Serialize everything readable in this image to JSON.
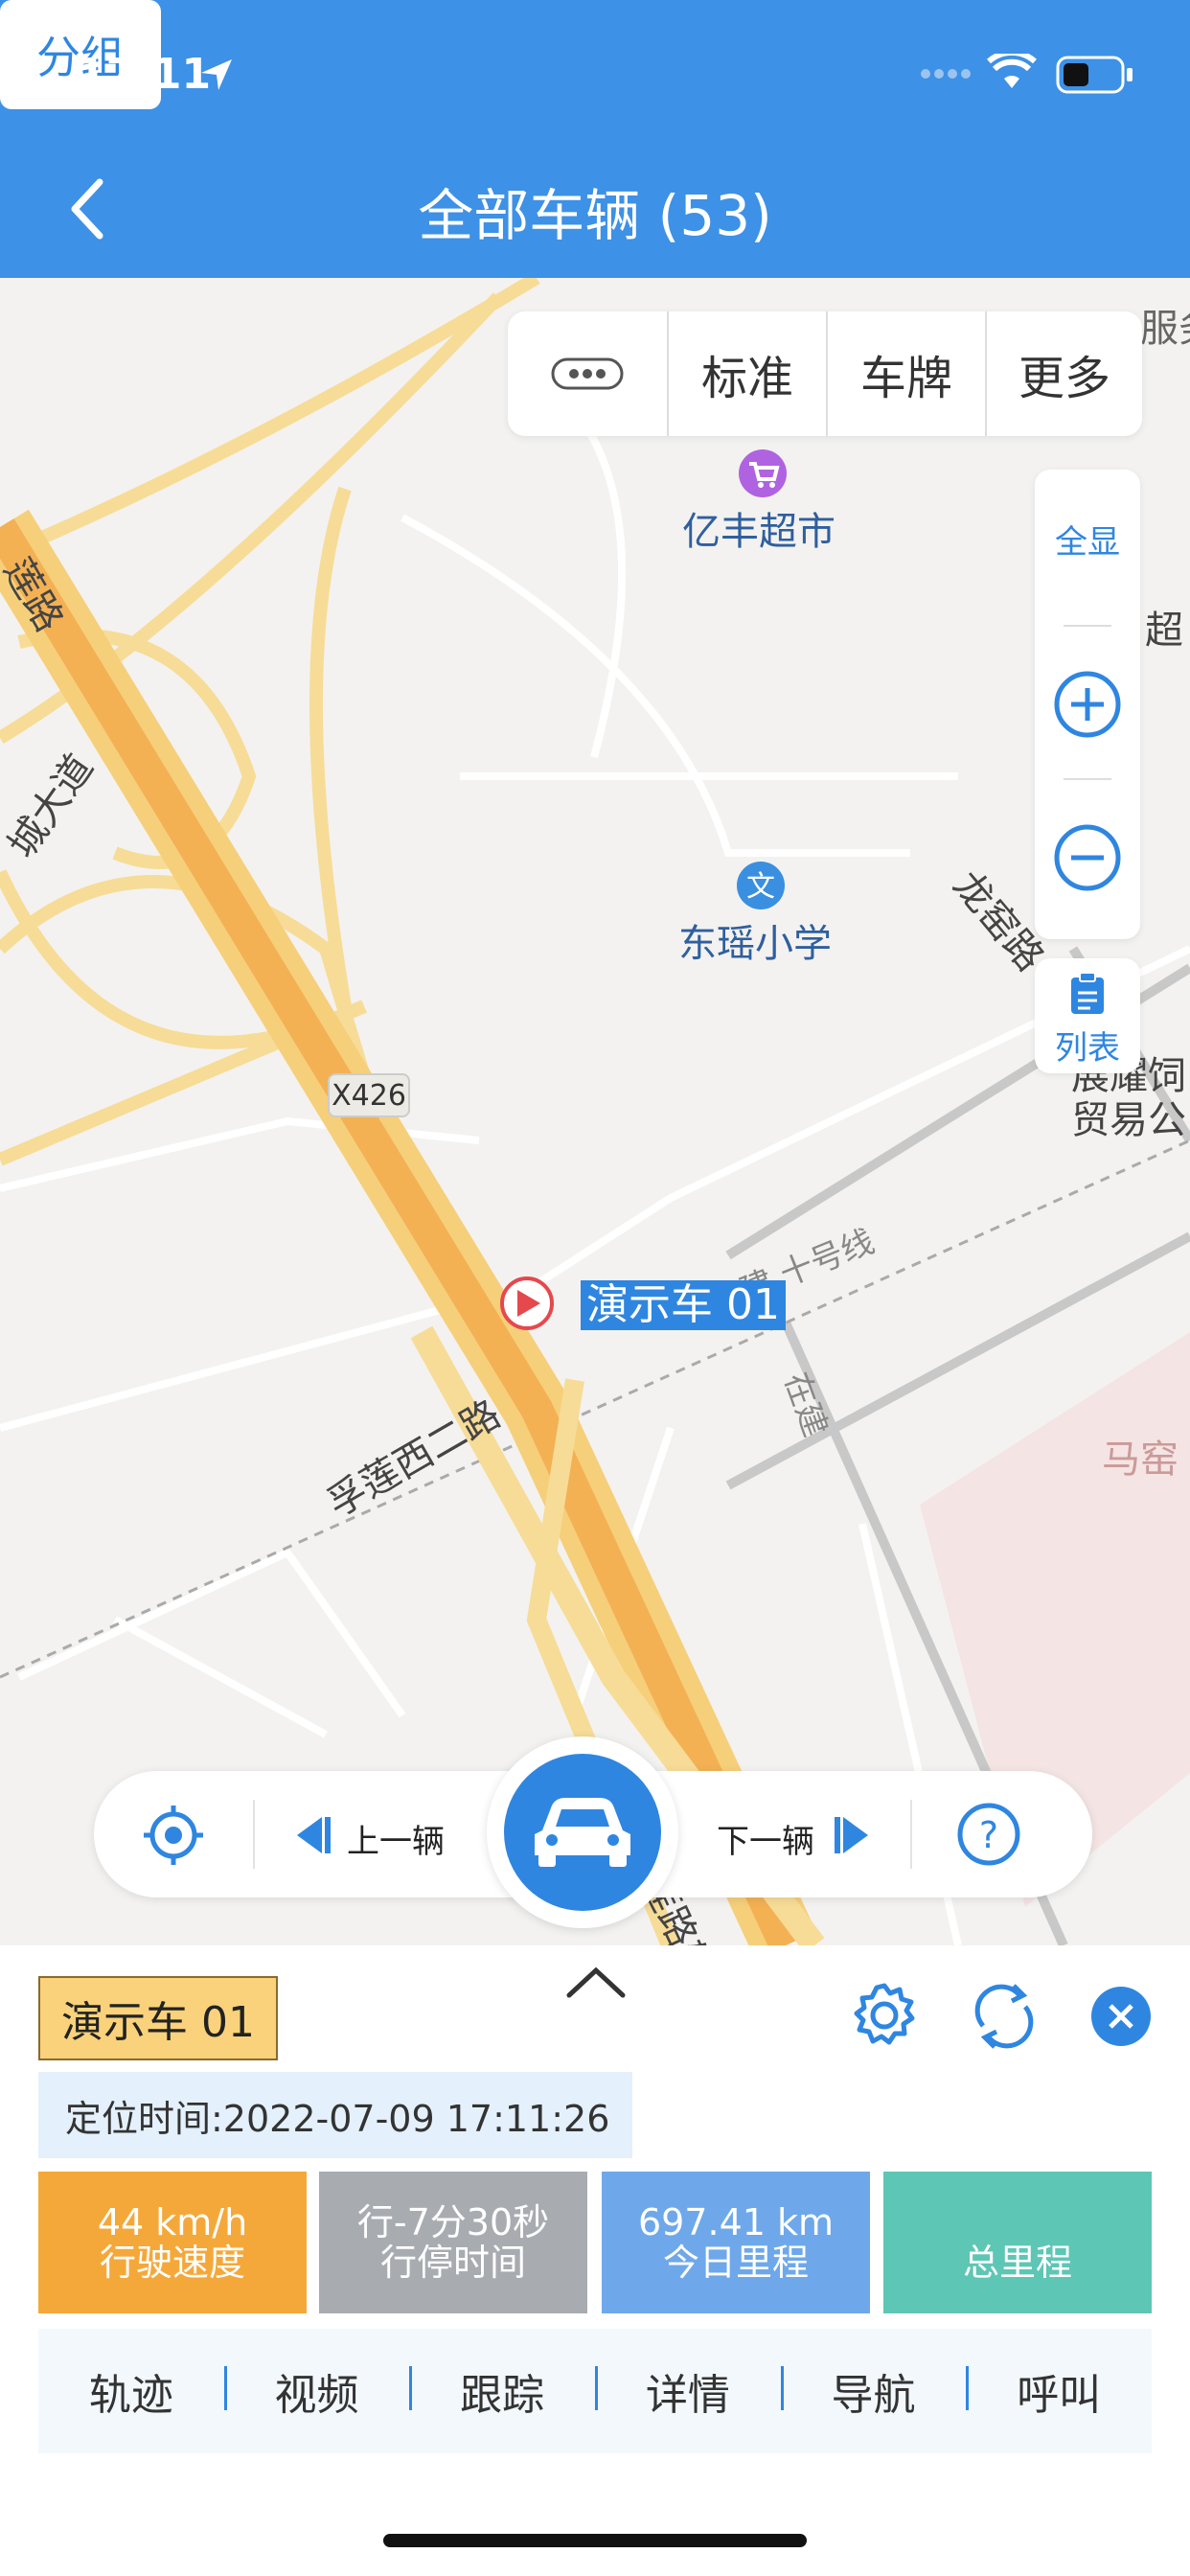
{
  "status_bar": {
    "time": "17:11"
  },
  "header": {
    "title": "全部车辆 (53)",
    "group_button": "分组"
  },
  "map_toolbar": {
    "items": [
      "标准",
      "车牌",
      "更多"
    ]
  },
  "zoom_panel": {
    "full_view": "全显"
  },
  "list_panel": {
    "label": "列表"
  },
  "map": {
    "pois": [
      "亿丰超市",
      "东瑶小学"
    ],
    "roads": [
      "X426",
      "孚莲西二路",
      "孚莲路辅路",
      "龙窑路",
      "在建",
      "在建 十号线",
      "服务",
      "超",
      "展耀饲",
      "贸易公",
      "马窑",
      "莲路",
      "城大道"
    ],
    "vehicle_label": "演示车 01"
  },
  "controls": {
    "prev": "上一辆",
    "next": "下一辆"
  },
  "sheet": {
    "plate": "演示车 01",
    "location_time": "定位时间:2022-07-09 17:11:26",
    "stats": [
      {
        "value": "44 km/h",
        "label": "行驶速度",
        "color": "#f5a83a"
      },
      {
        "value": "行-7分30秒",
        "label": "行停时间",
        "color": "#a8acb0"
      },
      {
        "value": "697.41 km",
        "label": "今日里程",
        "color": "#6ea8ea"
      },
      {
        "value": "",
        "label": "总里程",
        "color": "#5ec6b5"
      }
    ],
    "actions": [
      "轨迹",
      "视频",
      "跟踪",
      "详情",
      "导航",
      "呼叫"
    ]
  }
}
